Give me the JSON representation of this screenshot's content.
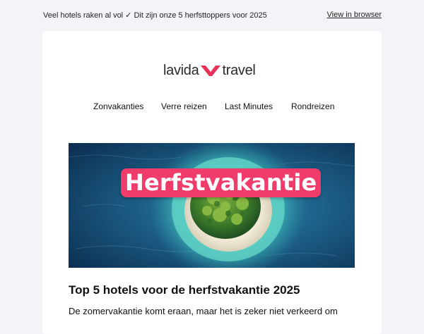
{
  "preheader": {
    "text": "Veel hotels raken al vol ✓ Dit zijn onze 5 herfsttoppers voor 2025",
    "view_in_browser": "View in browser"
  },
  "logo": {
    "left": "lavida",
    "right": "travel",
    "mark_icon": "v-chevron-logo-mark",
    "mark_color": "#e8325a"
  },
  "nav": {
    "items": [
      {
        "label": "Zonvakanties"
      },
      {
        "label": "Verre reizen"
      },
      {
        "label": "Last Minutes"
      },
      {
        "label": "Rondreizen"
      }
    ]
  },
  "hero": {
    "badge_text": "Herfstvakantie",
    "badge_color": "#f03c6a"
  },
  "article": {
    "headline": "Top 5 hotels voor de herfstvakantie 2025",
    "intro": "De zomervakantie komt eraan, maar het is zeker niet verkeerd om"
  }
}
